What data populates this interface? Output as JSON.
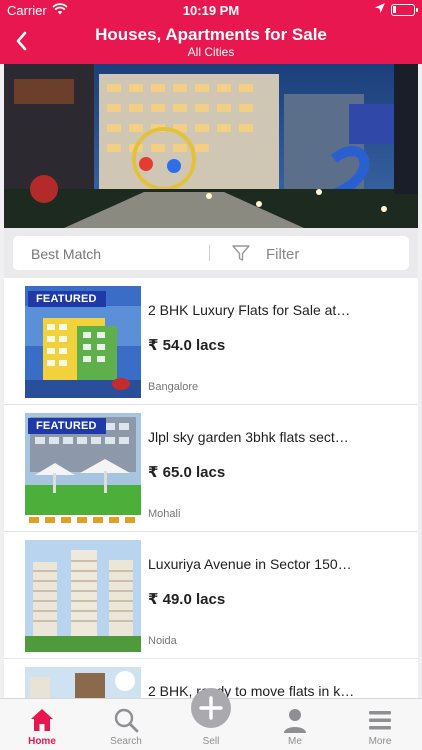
{
  "status_bar": {
    "carrier": "Carrier",
    "time": "10:19 PM"
  },
  "nav": {
    "title": "Houses, Apartments for Sale",
    "subtitle": "All Cities",
    "back_icon": "chevron-left-icon"
  },
  "filter_bar": {
    "sort_label": "Best Match",
    "filter_label": "Filter",
    "filter_icon": "funnel-icon"
  },
  "listings": [
    {
      "title": "2 BHK Luxury Flats for Sale at…",
      "price": "₹ 54.0 lacs",
      "city": "Bangalore",
      "badge": "FEATURED"
    },
    {
      "title": "Jlpl sky garden 3bhk flats sect…",
      "price": "₹ 65.0 lacs",
      "city": "Mohali",
      "badge": "FEATURED"
    },
    {
      "title": "Luxuriya Avenue in Sector 150…",
      "price": "₹ 49.0 lacs",
      "city": "Noida"
    },
    {
      "title": "2 BHK, ready to move flats in k…"
    }
  ],
  "tab_bar": {
    "items": [
      {
        "label": "Home",
        "icon": "home-icon",
        "active": true
      },
      {
        "label": "Search",
        "icon": "search-icon"
      },
      {
        "label": "Sell",
        "icon": "plus-icon"
      },
      {
        "label": "Me",
        "icon": "person-icon"
      },
      {
        "label": "More",
        "icon": "menu-icon"
      }
    ]
  },
  "colors": {
    "brand": "#e8174f",
    "badge": "#1f3aa8",
    "tab_inactive": "#8e8e93"
  }
}
